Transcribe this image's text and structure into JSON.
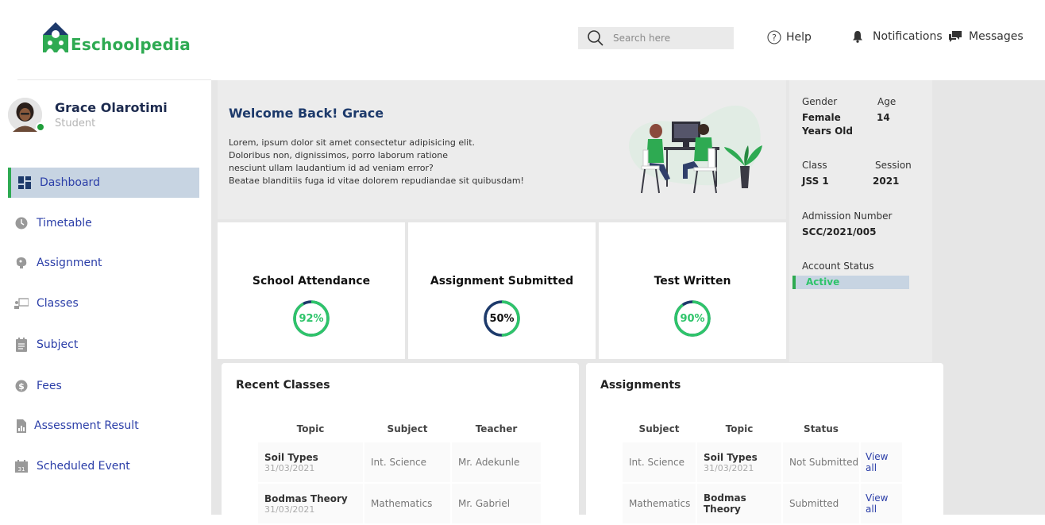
{
  "brand": {
    "name": "Eschoolpedia"
  },
  "header": {
    "search_placeholder": "Search here",
    "help": "Help",
    "notifications": "Notifications",
    "messages": "Messages"
  },
  "profile": {
    "name": "Grace Olarotimi",
    "role": "Student"
  },
  "sidebar": {
    "items": [
      {
        "label": "Dashboard",
        "icon": "dashboard-icon",
        "active": true
      },
      {
        "label": "Timetable",
        "icon": "clock-icon"
      },
      {
        "label": "Assignment",
        "icon": "brain-icon"
      },
      {
        "label": "Classes",
        "icon": "classroom-icon"
      },
      {
        "label": "Subject",
        "icon": "notepad-icon"
      },
      {
        "label": "Fees",
        "icon": "dollar-coin-icon"
      },
      {
        "label": "Assessment Result",
        "icon": "report-icon"
      },
      {
        "label": "Scheduled Event",
        "icon": "calendar-icon"
      }
    ]
  },
  "welcome": {
    "title": "Welcome Back! Grace",
    "lines": [
      "Lorem, ipsum dolor sit amet consectetur adipisicing elit.",
      "Doloribus non, dignissimos, porro laborum ratione",
      "nesciunt ullam laudantium id ad veniam error?",
      "Beatae blanditiis fuga id vitae dolorem repudiandae sit quibusdam!"
    ]
  },
  "info": {
    "gender_label": "Gender",
    "gender": "Female",
    "age_label": "Age",
    "age": "14",
    "age_unit": "Years Old",
    "class_label": "Class",
    "class": "JSS 1",
    "session_label": "Session",
    "session": "2021",
    "admission_label": "Admission Number",
    "admission": "SCC/2021/005",
    "status_label": "Account Status",
    "status": "Active"
  },
  "stats": [
    {
      "title": "School Attendance",
      "percent": 92,
      "text": "92%",
      "color": "#2ec46a"
    },
    {
      "title": "Assignment Submitted",
      "percent": 50,
      "text": "50%",
      "color": "#111111"
    },
    {
      "title": "Test Written",
      "percent": 90,
      "text": "90%",
      "color": "#2ec46a"
    }
  ],
  "recent_classes": {
    "title": "Recent Classes",
    "headers": [
      "Topic",
      "Subject",
      "Teacher"
    ],
    "rows": [
      {
        "topic": "Soil Types",
        "date": "31/03/2021",
        "subject": "Int. Science",
        "teacher": "Mr. Adekunle"
      },
      {
        "topic": "Bodmas Theory",
        "date": "31/03/2021",
        "subject": "Mathematics",
        "teacher": "Mr. Gabriel"
      }
    ]
  },
  "assignments": {
    "title": "Assignments",
    "headers": [
      "Subject",
      "Topic",
      "Status",
      ""
    ],
    "rows": [
      {
        "subject": "Int. Science",
        "topic": "Soil Types",
        "date": "31/03/2021",
        "status": "Not Submitted",
        "action": "View all"
      },
      {
        "subject": "Mathematics",
        "topic": "Bodmas Theory",
        "date": "",
        "status": "Submitted",
        "action": "View all"
      }
    ]
  },
  "colors": {
    "accent_green": "#2eaa52",
    "active_bg": "#c7d4e2",
    "ring_track": "#1d3a6b",
    "nav_text": "#2b3ea8"
  }
}
